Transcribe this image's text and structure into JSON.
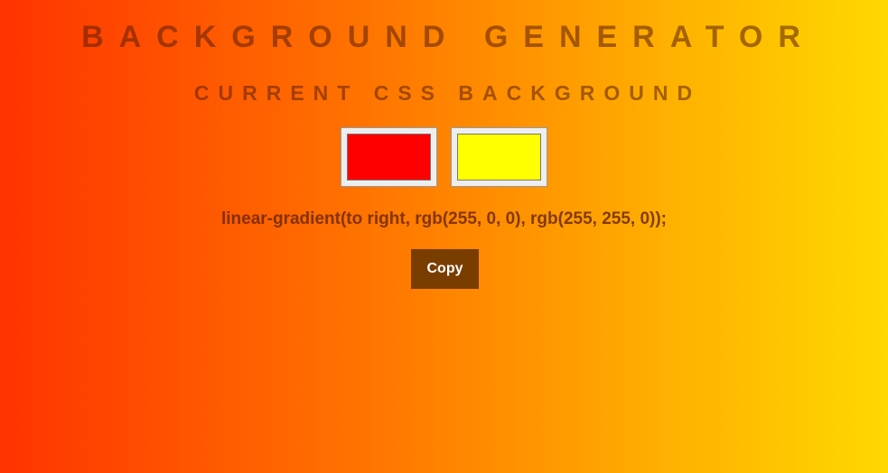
{
  "header": {
    "title": "BACKGROUND GENERATOR",
    "subtitle": "CURRENT CSS BACKGROUND"
  },
  "pickers": [
    {
      "name": "color1",
      "value": "#ff0000"
    },
    {
      "name": "color2",
      "value": "#ffff00"
    }
  ],
  "css_output": "linear-gradient(to right, rgb(255, 0, 0), rgb(255, 255, 0));",
  "actions": {
    "copy_label": "Copy"
  },
  "colors": {
    "button_bg": "#7a3d00",
    "text": "#6e280a"
  }
}
